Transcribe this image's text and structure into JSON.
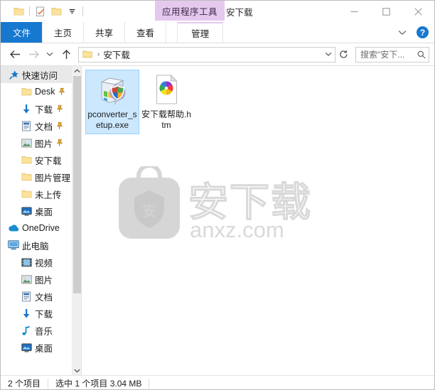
{
  "titlebar": {
    "context_tab_label": "应用程序工具",
    "window_title": "安下载",
    "quick_access": [
      {
        "name": "qat-folder-properties",
        "icon": "folder-icon"
      },
      {
        "name": "qat-new-folder",
        "icon": "checklist-icon"
      },
      {
        "name": "qat-folder",
        "icon": "folder-icon"
      },
      {
        "name": "qat-customize",
        "icon": "chevron-down-icon"
      }
    ],
    "controls": {
      "minimize": "—",
      "maximize": "□",
      "close": "✕"
    }
  },
  "ribbon": {
    "tabs": [
      {
        "label": "文件",
        "active_style": "file"
      },
      {
        "label": "主页",
        "active_style": "normal"
      },
      {
        "label": "共享",
        "active_style": "normal"
      },
      {
        "label": "查看",
        "active_style": "normal"
      },
      {
        "label": "管理",
        "active_style": "contextual"
      }
    ],
    "expand_icon": "chevron-down-icon",
    "help_label": "?"
  },
  "nav": {
    "back_icon": "arrow-left-icon",
    "forward_icon": "arrow-right-icon",
    "recent_icon": "chevron-down-icon",
    "up_icon": "arrow-up-icon",
    "breadcrumb": {
      "folder_icon": "folder-icon",
      "separator": "›",
      "path": "安下载"
    },
    "dropdown_icon": "chevron-down-icon",
    "refresh_icon": "refresh-icon",
    "search": {
      "placeholder": "搜索\"安下...",
      "icon": "search-icon"
    }
  },
  "sidebar": {
    "items": [
      {
        "label": "快速访问",
        "icon": "pin-star-icon",
        "indent": "top",
        "selected": true,
        "pinned": false
      },
      {
        "label": "Desk",
        "icon": "folder-icon",
        "indent": "1",
        "selected": false,
        "pinned": true
      },
      {
        "label": "下载",
        "icon": "download-arrow-icon",
        "indent": "1",
        "selected": false,
        "pinned": true
      },
      {
        "label": "文档",
        "icon": "document-icon",
        "indent": "1",
        "selected": false,
        "pinned": true
      },
      {
        "label": "图片",
        "icon": "pictures-icon",
        "indent": "1",
        "selected": false,
        "pinned": true
      },
      {
        "label": "安下载",
        "icon": "folder-icon",
        "indent": "1",
        "selected": false,
        "pinned": false
      },
      {
        "label": "图片管理",
        "icon": "folder-icon",
        "indent": "1",
        "selected": false,
        "pinned": false
      },
      {
        "label": "未上传",
        "icon": "folder-icon",
        "indent": "1",
        "selected": false,
        "pinned": false
      },
      {
        "label": "桌面",
        "icon": "desktop-icon",
        "indent": "1",
        "selected": false,
        "pinned": false
      },
      {
        "label": "OneDrive",
        "icon": "onedrive-cloud-icon",
        "indent": "top",
        "selected": false,
        "pinned": false
      },
      {
        "label": "此电脑",
        "icon": "this-pc-icon",
        "indent": "top",
        "selected": false,
        "pinned": false
      },
      {
        "label": "视频",
        "icon": "videos-icon",
        "indent": "1",
        "selected": false,
        "pinned": false
      },
      {
        "label": "图片",
        "icon": "pictures-icon",
        "indent": "1",
        "selected": false,
        "pinned": false
      },
      {
        "label": "文档",
        "icon": "document-icon",
        "indent": "1",
        "selected": false,
        "pinned": false
      },
      {
        "label": "下载",
        "icon": "download-arrow-icon",
        "indent": "1",
        "selected": false,
        "pinned": false
      },
      {
        "label": "音乐",
        "icon": "music-note-icon",
        "indent": "1",
        "selected": false,
        "pinned": false
      },
      {
        "label": "桌面",
        "icon": "desktop-icon",
        "indent": "1",
        "selected": false,
        "pinned": false
      }
    ],
    "scroll_up_icon": "chevron-up-icon",
    "scroll_down_icon": "chevron-down-icon"
  },
  "files": [
    {
      "name": "pconverter_setup.exe",
      "icon": "installer-exe-icon",
      "selected": true
    },
    {
      "name": "安下载帮助.htm",
      "icon": "html-pinwheel-icon",
      "selected": false
    }
  ],
  "watermark": {
    "brand_text": "安下载",
    "domain_text": "anxz.com",
    "badge_char": "安"
  },
  "statusbar": {
    "item_count": "2 个项目",
    "selection": "选中 1 个项目  3.04 MB"
  },
  "colors": {
    "accent_blue": "#1778d0",
    "context_purple": "#e5c8ee",
    "selection_blue": "#cce8ff",
    "selection_border": "#99d1ff",
    "watermark_gray": "#d9d9d9"
  }
}
